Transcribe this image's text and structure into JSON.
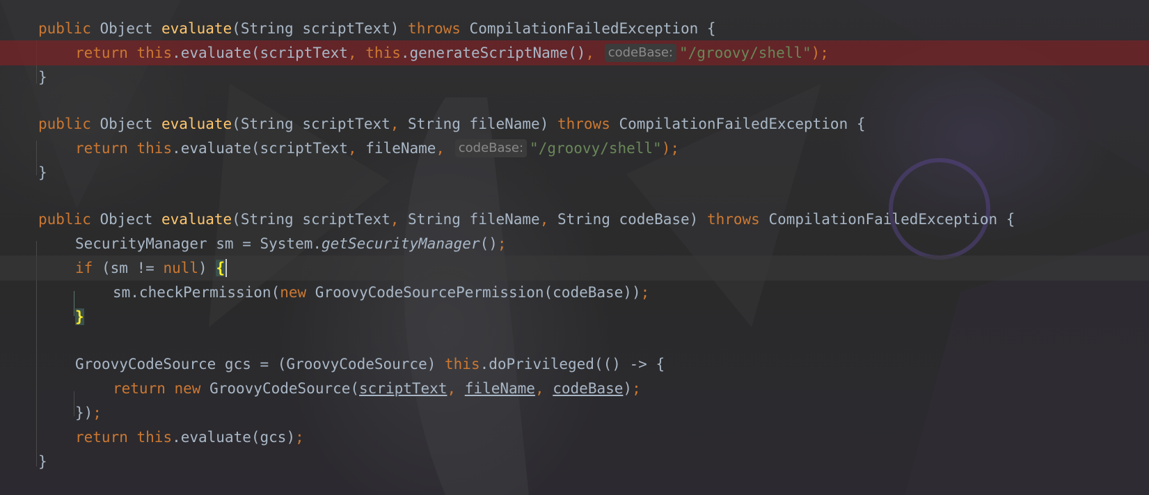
{
  "editor": {
    "lines": [
      [
        "public",
        " Object ",
        "evaluate",
        "(String scriptText) ",
        "throws",
        " CompilationFailedException {"
      ],
      [
        "return",
        " ",
        "this",
        ".evaluate(scriptText",
        ",",
        " ",
        "this",
        ".generateScriptName()",
        ",",
        " ",
        "codeBase:",
        " ",
        "\"/groovy/shell\"",
        ");"
      ],
      [
        "}"
      ],
      [
        "public",
        " Object ",
        "evaluate",
        "(String scriptText",
        ",",
        " String fileName) ",
        "throws",
        " CompilationFailedException {"
      ],
      [
        "return",
        " ",
        "this",
        ".evaluate(scriptText",
        ",",
        " fileName",
        ",",
        " ",
        "codeBase:",
        " ",
        "\"/groovy/shell\"",
        ");"
      ],
      [
        "}"
      ],
      [
        "public",
        " Object ",
        "evaluate",
        "(String scriptText",
        ",",
        " String fileName",
        ",",
        " String codeBase) ",
        "throws",
        " CompilationFailedException {"
      ],
      [
        "SecurityManager sm = System.",
        "getSecurityManager",
        "()",
        ";"
      ],
      [
        "if",
        " (sm != ",
        "null",
        ") ",
        "{"
      ],
      [
        "sm.checkPermission(",
        "new",
        " GroovyCodeSourcePermission(codeBase))",
        ";"
      ],
      [
        "}"
      ],
      [
        "GroovyCodeSource gcs = (GroovyCodeSource) ",
        "this",
        ".doPrivileged(() -> {"
      ],
      [
        "return",
        " ",
        "new",
        " GroovyCodeSource(",
        "scriptText",
        ",",
        " ",
        "fileName",
        ",",
        " ",
        "codeBase",
        ")",
        ";"
      ],
      [
        "})",
        ";"
      ],
      [
        "return",
        " ",
        "this",
        ".evaluate(gcs)",
        ";"
      ],
      [
        "}"
      ]
    ]
  },
  "theme": {
    "background": "#2b2b2b",
    "keyword": "#cc7832",
    "method_declaration": "#ffc66d",
    "string": "#6a8759",
    "default_text": "#a9b7c6",
    "breakpoint_line": "#78222a",
    "brace_match": "#ffef28",
    "inlay_hint": "#8a8a8a"
  }
}
